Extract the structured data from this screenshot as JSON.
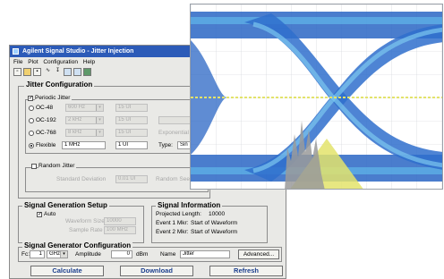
{
  "window": {
    "title": "Agilent Signal Studio - Jitter Injection"
  },
  "menu": [
    "File",
    "Plot",
    "Configuration",
    "Help"
  ],
  "toolbar": {
    "icons": [
      "new-icon",
      "open-icon",
      "save-icon",
      "signal-icon",
      "download-icon",
      "plot-icon",
      "grid-icon",
      "help-icon"
    ]
  },
  "jitter": {
    "title": "Jitter Configuration",
    "periodic": {
      "label": "Periodic Jitter",
      "checked": true,
      "rows": [
        {
          "name": "OC-48",
          "freq": "600 Hz",
          "amp": "15 UI"
        },
        {
          "name": "OC-192",
          "freq": "2 kHz",
          "amp": "15 UI"
        },
        {
          "name": "OC-768",
          "freq": "8 kHz",
          "amp": "15 UI"
        },
        {
          "name": "Flexible",
          "freq": "1 MHz",
          "amp": "1 UI"
        }
      ],
      "selected": "Flexible",
      "type_label": "Type:",
      "type_value": "Sin",
      "expo_label": "Exponential"
    },
    "random": {
      "label": "Random Jitter",
      "std_label": "Standard Deviation",
      "std_value": "0.01 UI",
      "random_seed_label": "Random See"
    }
  },
  "siggen": {
    "title": "Signal Generation Setup",
    "auto_label": "Auto",
    "waveform_label": "Waveform Size",
    "waveform_value": "10000",
    "sample_label": "Sample Rate",
    "sample_value": "100 MHz"
  },
  "info": {
    "title": "Signal Information",
    "projected_label": "Projected Length:",
    "projected_value": "10000",
    "event1_label": "Event 1 Mkr:",
    "event1_value": "Start of Waveform",
    "event2_label": "Event 2 Mkr:",
    "event2_value": "Start of Waveform"
  },
  "generator": {
    "title": "Signal Generator Configuration",
    "fc_label": "Fc:",
    "fc_value": "1",
    "fc_unit": "GHz",
    "amp_label": "Amplitude",
    "amp_value": "0",
    "amp_unit": "dBm",
    "name_label": "Name",
    "name_value": "Jitter",
    "advanced_label": "Advanced..."
  },
  "buttons": {
    "calculate": "Calculate",
    "download": "Download",
    "refresh": "Refresh"
  },
  "colors": {
    "trace_blue": "#1f5fbf",
    "trace_cyan": "#48b9e8",
    "marker_yellow": "#e3e36b",
    "bg_white": "#ffffff",
    "title_blue": "#2c5bb8"
  }
}
